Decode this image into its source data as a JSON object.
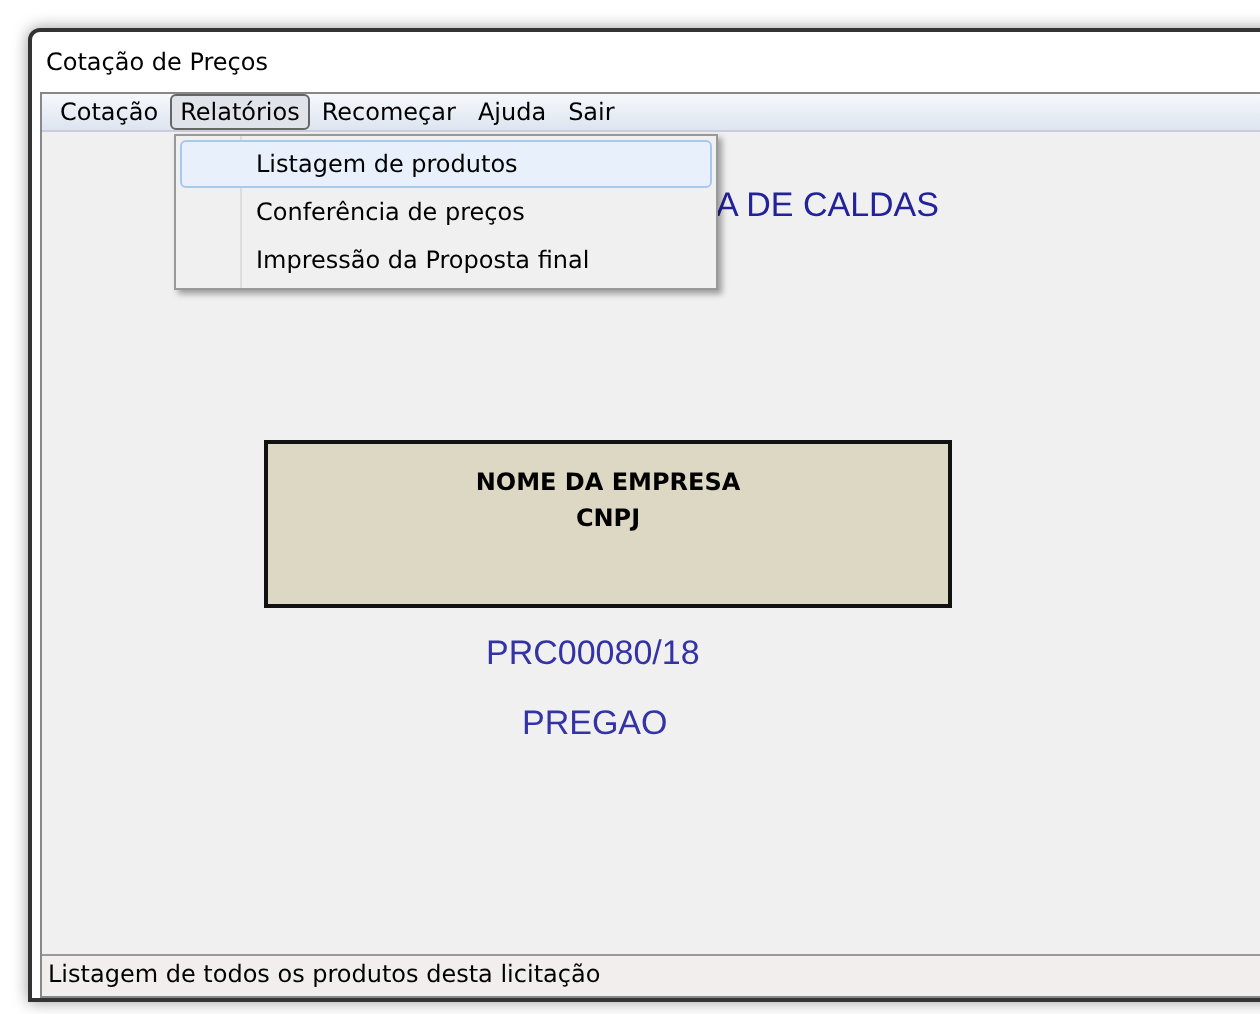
{
  "window": {
    "title": "Cotação de Preços"
  },
  "menu_bar": [
    {
      "label": "Cotação",
      "selected": false
    },
    {
      "label": "Relatórios",
      "selected": true
    },
    {
      "label": "Recomeçar",
      "selected": false
    },
    {
      "label": "Ajuda",
      "selected": false
    },
    {
      "label": "Sair",
      "selected": false
    }
  ],
  "dropdown": [
    {
      "label": "Listagem de produtos",
      "selected": true
    },
    {
      "label": "Conferência de preços",
      "selected": false
    },
    {
      "label": "Impressão da Proposta final",
      "selected": false
    }
  ],
  "heading": "A DE CALDAS",
  "company_box": {
    "name": "NOME DA EMPRESA",
    "cnpj": "CNPJ"
  },
  "process_number": "PRC00080/18",
  "modality": "PREGAO",
  "status_bar": "Listagem de todos os produtos desta licitação"
}
